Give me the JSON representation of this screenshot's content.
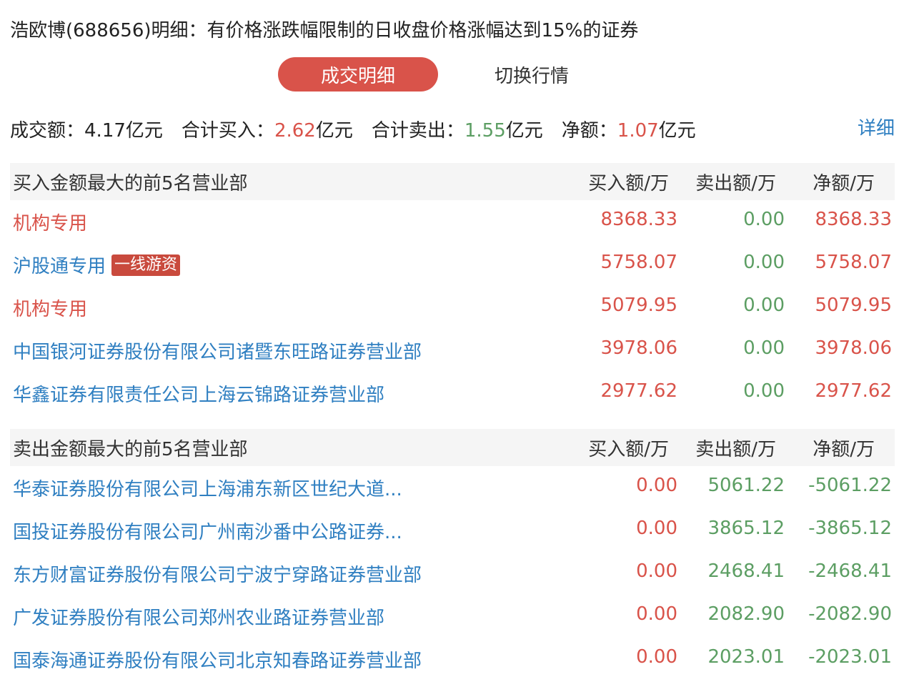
{
  "title": "浩欧博(688656)明细：有价格涨跌幅限制的日收盘价格涨幅达到15%的证券",
  "tabs": {
    "active": "成交明细",
    "other": "切换行情"
  },
  "summary": {
    "turnover_label": "成交额：",
    "turnover_value": "4.17亿元",
    "buy_label": "合计买入：",
    "buy_value": "2.62",
    "buy_unit": "亿元",
    "sell_label": "合计卖出：",
    "sell_value": "1.55",
    "sell_unit": "亿元",
    "net_label": "净额：",
    "net_value": "1.07",
    "net_unit": "亿元",
    "detail_link": "详细"
  },
  "buy_section": {
    "header": "买入金额最大的前5名营业部",
    "col_buy": "买入额/万",
    "col_sell": "卖出额/万",
    "col_net": "净额/万",
    "rows": [
      {
        "name": "机构专用",
        "buy": "8368.33",
        "sell": "0.00",
        "net": "8368.33",
        "badge": ""
      },
      {
        "name": "沪股通专用",
        "buy": "5758.07",
        "sell": "0.00",
        "net": "5758.07",
        "badge": "一线游资"
      },
      {
        "name": "机构专用",
        "buy": "5079.95",
        "sell": "0.00",
        "net": "5079.95",
        "badge": ""
      },
      {
        "name": "中国银河证券股份有限公司诸暨东旺路证券营业部",
        "buy": "3978.06",
        "sell": "0.00",
        "net": "3978.06",
        "badge": ""
      },
      {
        "name": "华鑫证券有限责任公司上海云锦路证券营业部",
        "buy": "2977.62",
        "sell": "0.00",
        "net": "2977.62",
        "badge": ""
      }
    ]
  },
  "sell_section": {
    "header": "卖出金额最大的前5名营业部",
    "col_buy": "买入额/万",
    "col_sell": "卖出额/万",
    "col_net": "净额/万",
    "rows": [
      {
        "name": "华泰证券股份有限公司上海浦东新区世纪大道...",
        "buy": "0.00",
        "sell": "5061.22",
        "net": "-5061.22"
      },
      {
        "name": "国投证券股份有限公司广州南沙番中公路证券...",
        "buy": "0.00",
        "sell": "3865.12",
        "net": "-3865.12"
      },
      {
        "name": "东方财富证券股份有限公司宁波宁穿路证券营业部",
        "buy": "0.00",
        "sell": "2468.41",
        "net": "-2468.41"
      },
      {
        "name": "广发证券股份有限公司郑州农业路证券营业部",
        "buy": "0.00",
        "sell": "2082.90",
        "net": "-2082.90"
      },
      {
        "name": "国泰海通证券股份有限公司北京知春路证券营业部",
        "buy": "0.00",
        "sell": "2023.01",
        "net": "-2023.01"
      }
    ]
  },
  "colors": {
    "red": "#d9534a",
    "green": "#5c9e63",
    "blue": "#2f7fc1"
  }
}
